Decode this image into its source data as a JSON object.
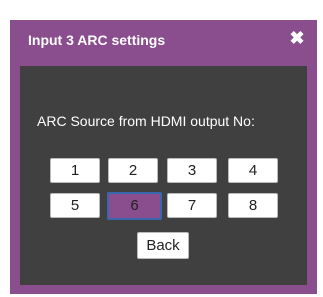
{
  "dialog": {
    "title": "Input 3 ARC settings",
    "close_glyph": "✖",
    "prompt": "ARC Source from HDMI output No:",
    "numbers": [
      "1",
      "2",
      "3",
      "4",
      "5",
      "6",
      "7",
      "8"
    ],
    "selected": "6",
    "back_label": "Back"
  },
  "colors": {
    "accent": "#8a4d8e",
    "panel": "#404040",
    "selected_border": "#3a66b0"
  }
}
